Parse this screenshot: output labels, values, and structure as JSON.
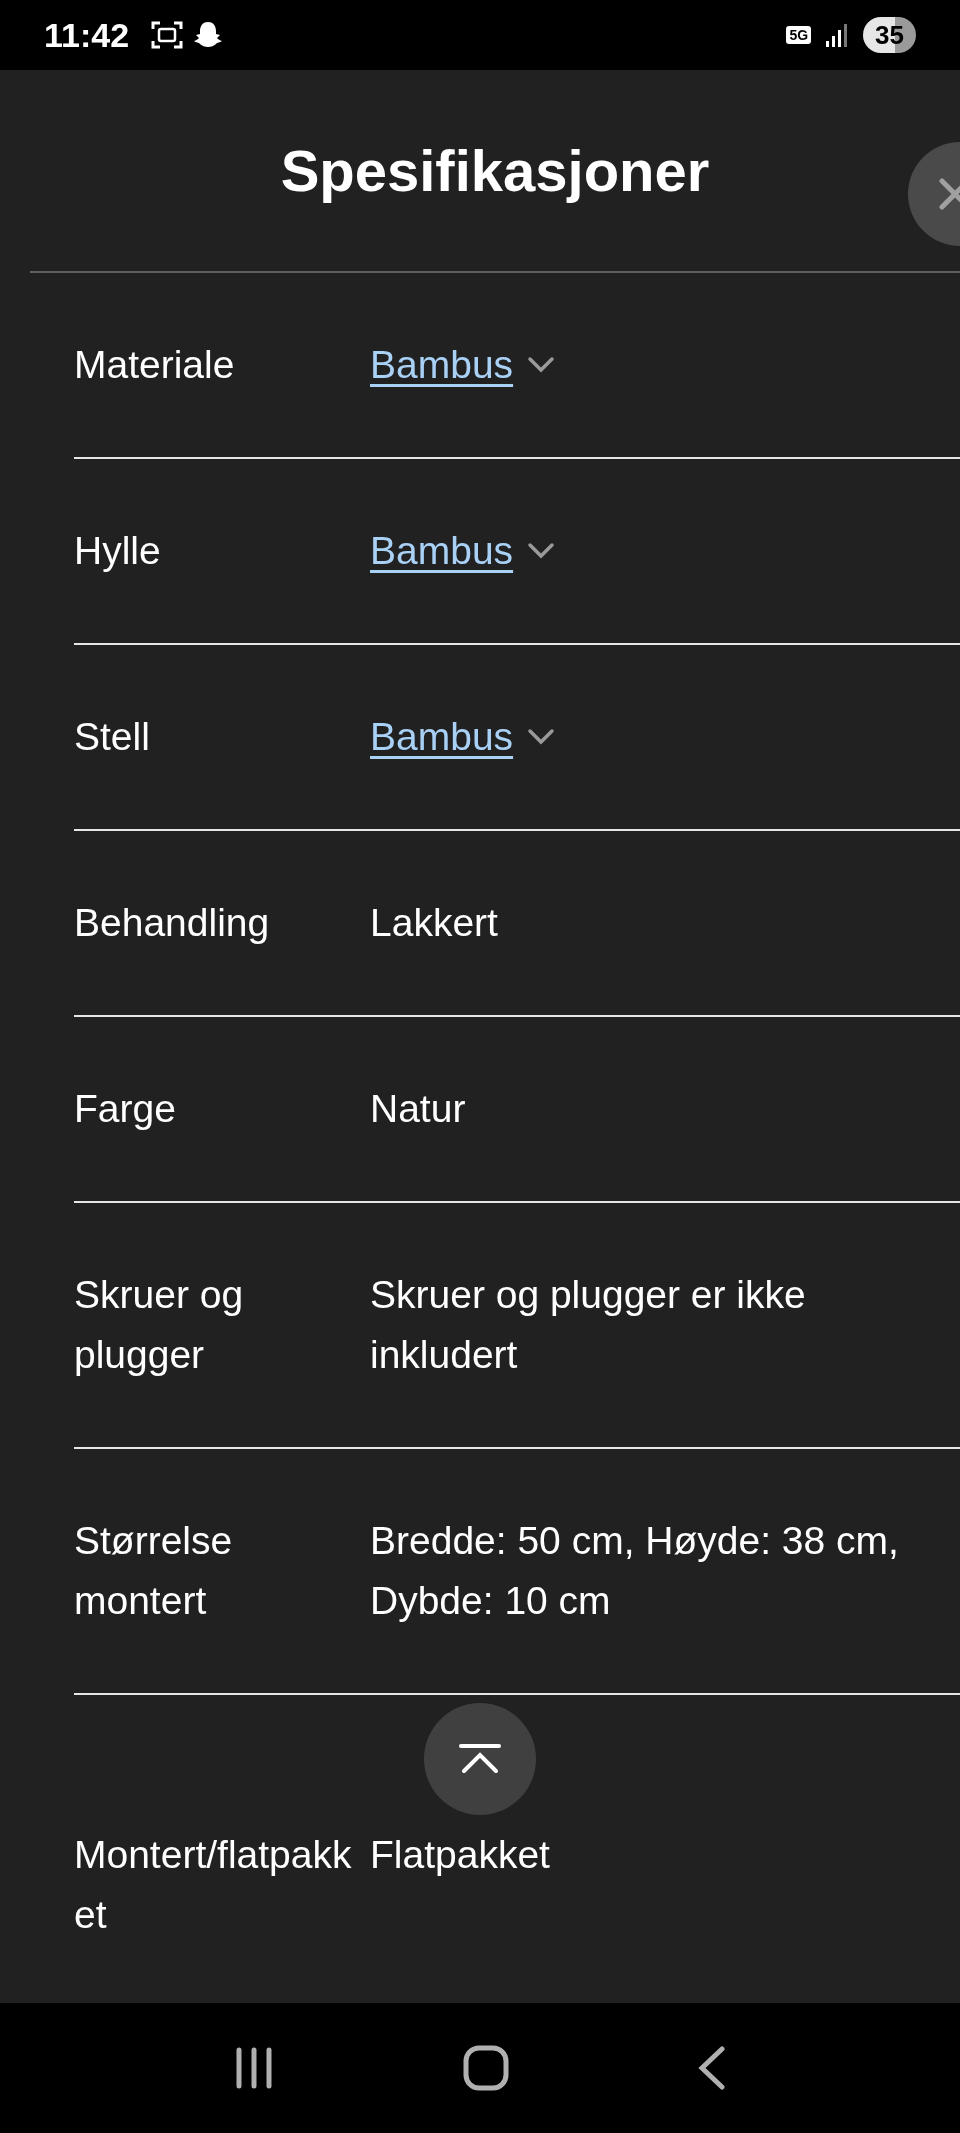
{
  "status_bar": {
    "time": "11:42",
    "network": "5G",
    "battery": "35"
  },
  "title": "Spesifikasjoner",
  "specs": [
    {
      "label": "Materiale",
      "value": "Bambus",
      "kind": "link"
    },
    {
      "label": "Hylle",
      "value": "Bambus",
      "kind": "link"
    },
    {
      "label": "Stell",
      "value": "Bambus",
      "kind": "link"
    },
    {
      "label": "Behandling",
      "value": "Lakkert",
      "kind": "text"
    },
    {
      "label": "Farge",
      "value": "Natur",
      "kind": "text"
    },
    {
      "label": "Skruer og plugger",
      "value": "Skruer og plugger er ikke inkludert",
      "kind": "text"
    },
    {
      "label": "Størrelse montert",
      "value": "Bredde: 50 cm, Høyde: 38 cm, Dybde: 10 cm",
      "kind": "text"
    },
    {
      "label": "Montert/flatpakket",
      "value": "Flatpakket",
      "kind": "text"
    }
  ]
}
